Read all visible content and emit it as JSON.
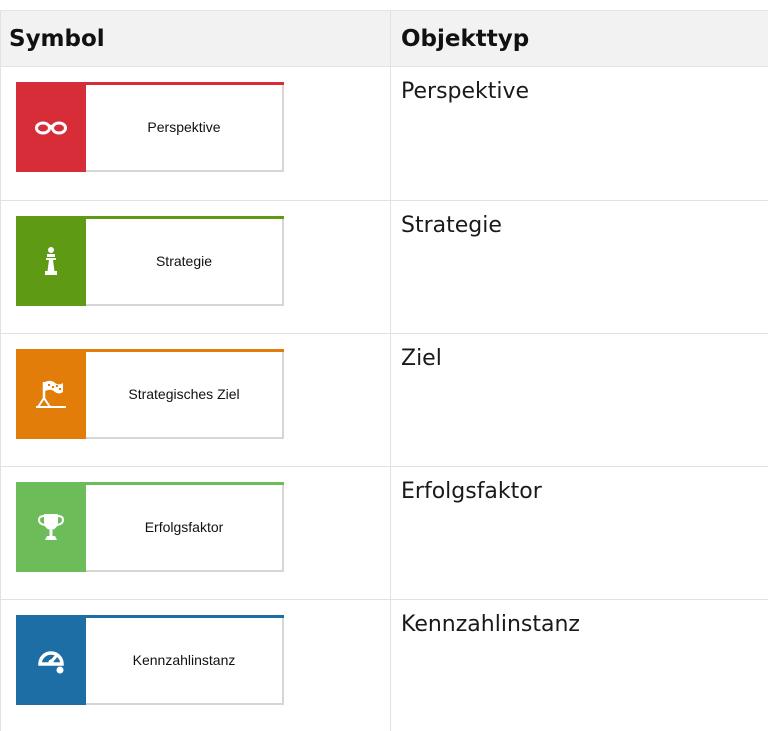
{
  "header": {
    "symbol": "Symbol",
    "object_type": "Objekttyp"
  },
  "rows": [
    {
      "label": "Perspektive",
      "type": "Perspektive",
      "color": "#d62d38",
      "icon": "glasses-icon"
    },
    {
      "label": "Strategie",
      "type": "Strategie",
      "color": "#5e9a14",
      "icon": "chess-piece-icon"
    },
    {
      "label": "Strategisches Ziel",
      "type": "Ziel",
      "color": "#e37d0a",
      "icon": "goal-flag-icon"
    },
    {
      "label": "Erfolgsfaktor",
      "type": "Erfolgsfaktor",
      "color": "#6cbd5a",
      "icon": "trophy-icon"
    },
    {
      "label": "Kennzahlinstanz",
      "type": "Kennzahlinstanz",
      "color": "#1d6ea4",
      "icon": "gauge-icon"
    }
  ]
}
